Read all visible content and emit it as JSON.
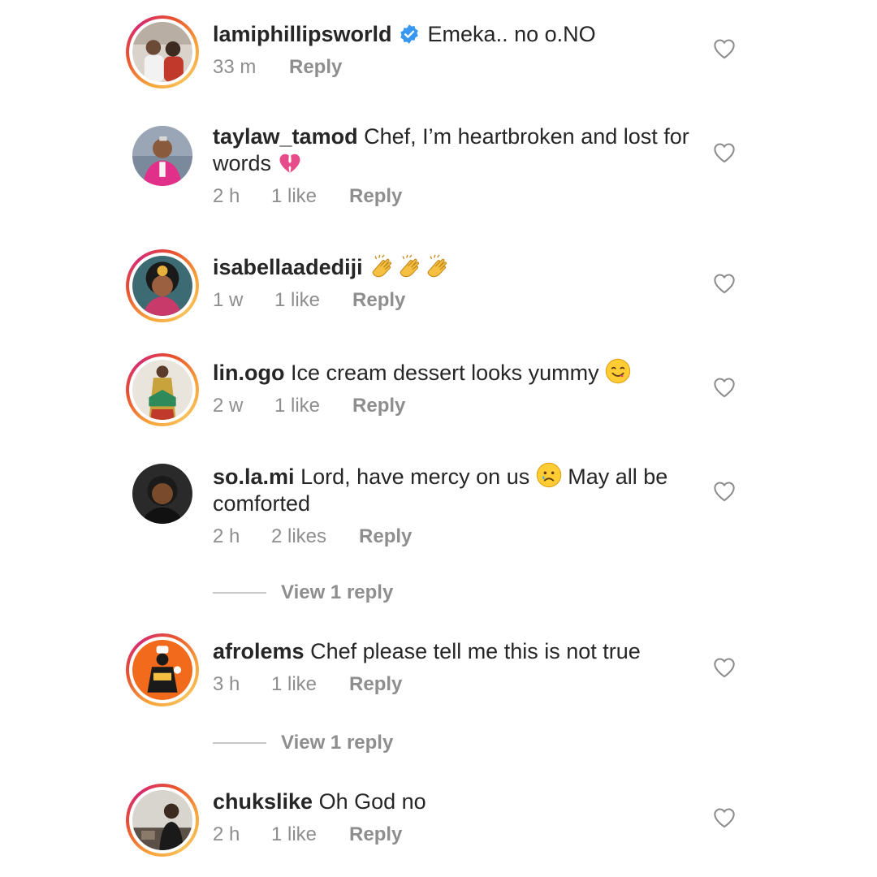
{
  "comments": [
    {
      "username": "lamiphillipsworld",
      "verified": true,
      "text": "Emeka.. no o.NO",
      "emoji": [],
      "time": "33 m",
      "likes": "",
      "reply": "Reply",
      "story_ring": true
    },
    {
      "username": "taylaw_tamod",
      "verified": false,
      "text": "Chef, I’m heartbroken and lost for words",
      "emoji": [
        "broken-heart-emoji"
      ],
      "time": "2 h",
      "likes": "1 like",
      "reply": "Reply",
      "story_ring": false
    },
    {
      "username": "isabellaadediji",
      "verified": false,
      "text": "",
      "emoji": [
        "clapping-hands-emoji",
        "clapping-hands-emoji",
        "clapping-hands-emoji"
      ],
      "time": "1 w",
      "likes": "1 like",
      "reply": "Reply",
      "story_ring": true
    },
    {
      "username": "lin.ogo",
      "verified": false,
      "text": "Ice cream dessert looks yummy",
      "emoji": [
        "yummy-face-emoji"
      ],
      "time": "2 w",
      "likes": "1 like",
      "reply": "Reply",
      "story_ring": true
    },
    {
      "username": "so.la.mi",
      "verified": false,
      "text_before_emoji": "Lord, have mercy on us",
      "text_after_emoji": "May all be comforted",
      "emoji": [
        "crying-face-emoji"
      ],
      "time": "2 h",
      "likes": "2 likes",
      "reply": "Reply",
      "story_ring": false,
      "view_replies": "View 1 reply"
    },
    {
      "username": "afrolems",
      "verified": false,
      "text": "Chef please tell me this is not true",
      "emoji": [],
      "time": "3 h",
      "likes": "1 like",
      "reply": "Reply",
      "story_ring": true,
      "view_replies": "View 1 reply"
    },
    {
      "username": "chukslike",
      "verified": false,
      "text": "Oh God no",
      "emoji": [],
      "time": "2 h",
      "likes": "1 like",
      "reply": "Reply",
      "story_ring": true
    }
  ],
  "colors": {
    "text": "#262626",
    "meta": "#8e8e8e",
    "verified": "#3897f0",
    "divider": "#c7c7c7"
  }
}
